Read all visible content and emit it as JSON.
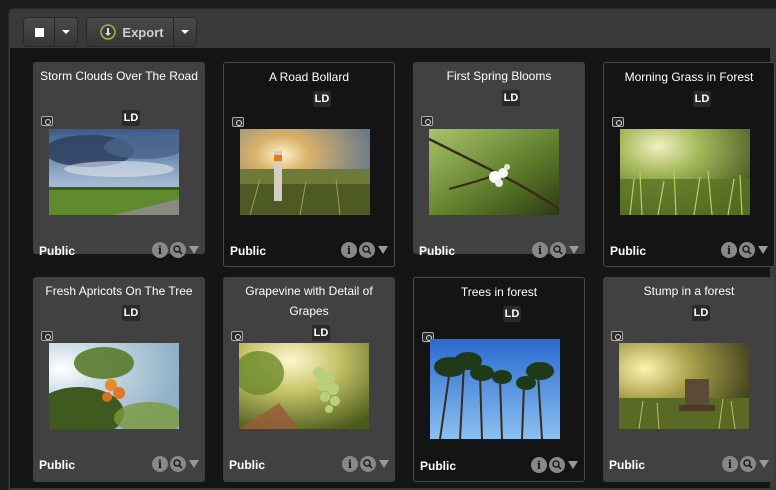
{
  "toolbar": {
    "select_icon": "checkbox-square-icon",
    "export_label": "Export",
    "export_icon": "export-download-icon"
  },
  "cards": [
    {
      "title": "Storm Clouds Over The Road",
      "badge": "LD",
      "visibility": "Public",
      "selected": false
    },
    {
      "title": "A Road Bollard",
      "badge": "LD",
      "visibility": "Public",
      "selected": true
    },
    {
      "title": "First Spring Blooms",
      "badge": "LD",
      "visibility": "Public",
      "selected": false
    },
    {
      "title": "Morning Grass in Forest",
      "badge": "LD",
      "visibility": "Public",
      "selected": true
    },
    {
      "title": "Fresh Apricots On The Tree",
      "badge": "LD",
      "visibility": "Public",
      "selected": false
    },
    {
      "title": "Grapevine with Detail of Grapes",
      "badge": "LD",
      "visibility": "Public",
      "selected": false
    },
    {
      "title": "Trees in forest",
      "badge": "LD",
      "visibility": "Public",
      "selected": true
    },
    {
      "title": "Stump in a forest",
      "badge": "LD",
      "visibility": "Public",
      "selected": false
    }
  ],
  "card_actions": {
    "info_glyph": "i",
    "info_icon": "info-icon",
    "zoom_icon": "magnifier-icon",
    "menu_icon": "dropdown-triangle-icon"
  }
}
